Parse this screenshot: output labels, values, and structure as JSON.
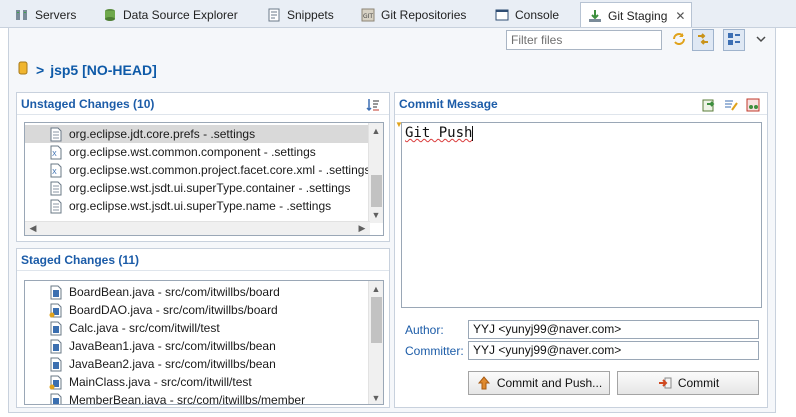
{
  "tabs": [
    {
      "label": "Servers",
      "icon": "servers-icon"
    },
    {
      "label": "Data Source Explorer",
      "icon": "data-source-icon"
    },
    {
      "label": "Snippets",
      "icon": "snippets-icon"
    },
    {
      "label": "Git Repositories",
      "icon": "git-repositories-icon"
    },
    {
      "label": "Console",
      "icon": "console-icon"
    },
    {
      "label": "Git Staging",
      "icon": "git-staging-icon",
      "active": true
    }
  ],
  "toolbar": {
    "filter_placeholder": "Filter files"
  },
  "repo": {
    "separator": ">",
    "name": "jsp5 [NO-HEAD]"
  },
  "unstaged": {
    "title": "Unstaged Changes (10)",
    "items": [
      {
        "label": "org.eclipse.jdt.core.prefs - .settings",
        "icon": "prefs-file-icon",
        "selected": true
      },
      {
        "label": "org.eclipse.wst.common.component - .settings",
        "icon": "xml-file-icon"
      },
      {
        "label": "org.eclipse.wst.common.project.facet.core.xml - .settings",
        "icon": "xml-file-icon"
      },
      {
        "label": "org.eclipse.wst.jsdt.ui.superType.container - .settings",
        "icon": "text-file-icon"
      },
      {
        "label": "org.eclipse.wst.jsdt.ui.superType.name - .settings",
        "icon": "text-file-icon"
      }
    ]
  },
  "staged": {
    "title": "Staged Changes (11)",
    "items": [
      {
        "label": "BoardBean.java - src/com/itwillbs/board",
        "icon": "java-file-icon"
      },
      {
        "label": "BoardDAO.java - src/com/itwillbs/board",
        "icon": "java-file-added-icon"
      },
      {
        "label": "Calc.java - src/com/itwill/test",
        "icon": "java-file-icon"
      },
      {
        "label": "JavaBean1.java - src/com/itwillbs/bean",
        "icon": "java-file-icon"
      },
      {
        "label": "JavaBean2.java - src/com/itwillbs/bean",
        "icon": "java-file-icon"
      },
      {
        "label": "MainClass.java - src/com/itwill/test",
        "icon": "java-file-added-icon"
      },
      {
        "label": "MemberBean.java - src/com/itwillbs/member",
        "icon": "java-file-icon"
      }
    ]
  },
  "commit": {
    "title": "Commit Message",
    "message": "Git Push",
    "author_label": "Author:",
    "author_value": "YYJ <yunyj99@naver.com>",
    "committer_label": "Committer:",
    "committer_value": "YYJ <yunyj99@naver.com>",
    "commit_and_push_label": "Commit and Push...",
    "commit_label": "Commit"
  },
  "colors": {
    "accent": "#1c5ca8",
    "tab_bar": "#e9eef5",
    "selection": "#d9d9d9"
  }
}
